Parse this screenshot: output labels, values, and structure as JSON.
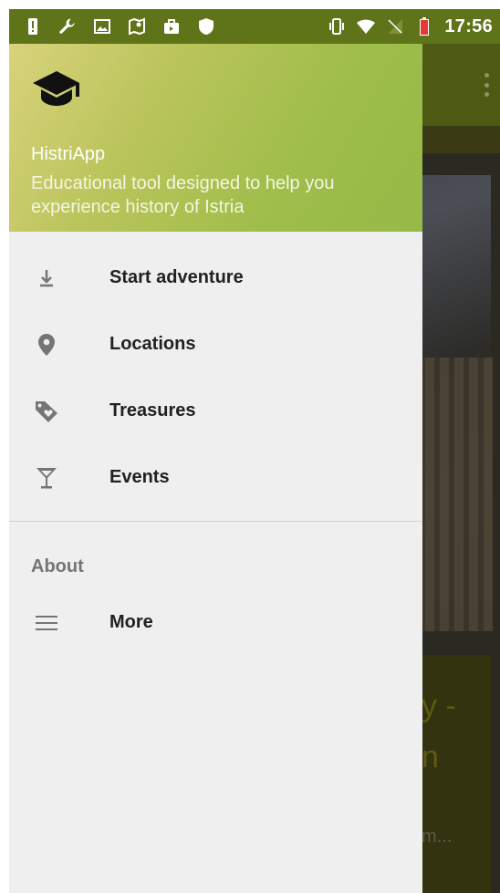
{
  "status_bar": {
    "time": "17:56",
    "icons_left": [
      "alert-icon",
      "wrench-icon",
      "image-icon",
      "map-icon",
      "briefcase-icon",
      "shield-icon"
    ],
    "icons_right": [
      "vibrate-icon",
      "wifi-icon",
      "no-sim-icon",
      "battery-low-icon"
    ],
    "battery_color": "#e53935"
  },
  "drawer": {
    "header": {
      "logo_icon": "graduation-cap-icon",
      "app_name": "HistriApp",
      "description": "Educational tool designed to help you experience history of Istria"
    },
    "items": [
      {
        "label": "Start adventure",
        "icon": "download-arrow-icon"
      },
      {
        "label": "Locations",
        "icon": "location-pin-icon"
      },
      {
        "label": "Treasures",
        "icon": "tag-heart-icon"
      },
      {
        "label": "Events",
        "icon": "cocktail-glass-icon"
      }
    ],
    "section_title": "About",
    "section_items": [
      {
        "label": "More",
        "icon": "menu-lines-icon"
      }
    ]
  },
  "background": {
    "card_title": "y -\nn",
    "card_subtitle": "m..."
  },
  "colors": {
    "accent_green": "#9ebd4a",
    "status_bar": "#5f7318",
    "drawer_bg": "#efefef",
    "icon_gray": "#757575"
  }
}
